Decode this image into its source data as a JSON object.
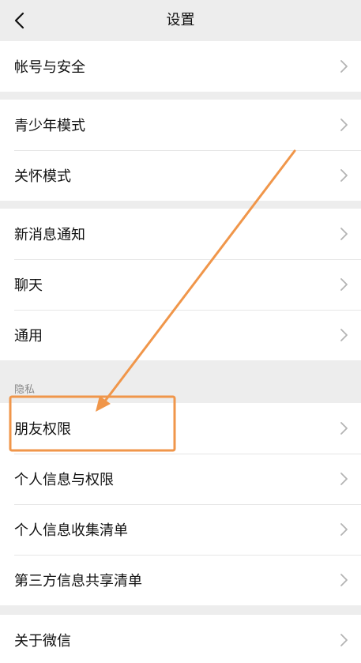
{
  "header": {
    "title": "设置",
    "back_icon": "chevron-left-icon"
  },
  "groups": [
    {
      "items": [
        {
          "label": "帐号与安全"
        }
      ]
    },
    {
      "items": [
        {
          "label": "青少年模式"
        },
        {
          "label": "关怀模式"
        }
      ]
    },
    {
      "items": [
        {
          "label": "新消息通知"
        },
        {
          "label": "聊天"
        },
        {
          "label": "通用"
        }
      ]
    },
    {
      "caption": "隐私",
      "items": [
        {
          "label": "朋友权限"
        },
        {
          "label": "个人信息与权限"
        },
        {
          "label": "个人信息收集清单"
        },
        {
          "label": "第三方信息共享清单"
        }
      ]
    },
    {
      "items": [
        {
          "label": "关于微信"
        }
      ]
    }
  ],
  "annotation": {
    "color": "#f0964a",
    "highlighted_item": "朋友权限"
  },
  "colors": {
    "background": "#ededed",
    "row": "#ffffff",
    "chevron": "#b3b3b3"
  }
}
